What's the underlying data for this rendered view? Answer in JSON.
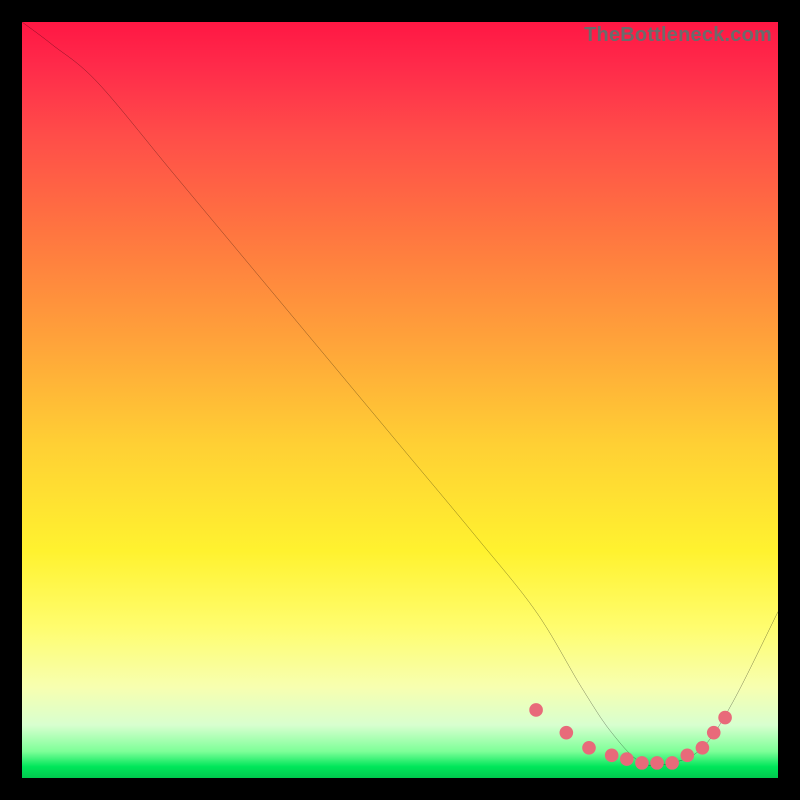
{
  "watermark": "TheBottleneck.com",
  "chart_data": {
    "type": "line",
    "title": "",
    "xlabel": "",
    "ylabel": "",
    "xlim": [
      0,
      100
    ],
    "ylim": [
      0,
      100
    ],
    "series": [
      {
        "name": "bottleneck-curve",
        "x": [
          0,
          4,
          10,
          20,
          30,
          40,
          50,
          60,
          68,
          74,
          78,
          82,
          86,
          90,
          94,
          100
        ],
        "y": [
          100,
          97,
          92,
          80,
          68,
          56,
          44,
          32,
          22,
          12,
          6,
          2,
          2,
          4,
          10,
          22
        ]
      }
    ],
    "markers": {
      "name": "flat-region-markers",
      "color": "#e86a7a",
      "x": [
        68,
        72,
        75,
        78,
        80,
        82,
        84,
        86,
        88,
        90,
        91.5,
        93
      ],
      "y": [
        9,
        6,
        4,
        3,
        2.5,
        2,
        2,
        2,
        3,
        4,
        6,
        8
      ]
    }
  }
}
